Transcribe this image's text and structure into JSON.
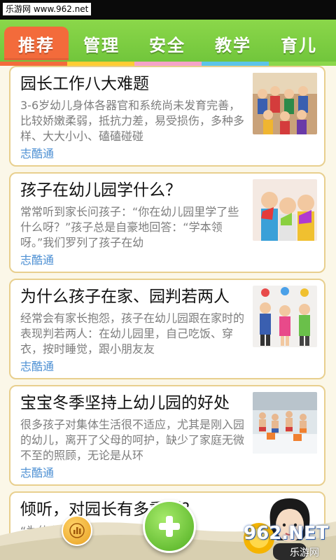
{
  "status_bar": {
    "watermark": "乐游网 www.962.net"
  },
  "tabs": [
    {
      "label": "推荐",
      "active": true
    },
    {
      "label": "管理",
      "active": false
    },
    {
      "label": "安全",
      "active": false
    },
    {
      "label": "教学",
      "active": false
    },
    {
      "label": "育儿",
      "active": false
    }
  ],
  "articles": [
    {
      "title": "园长工作八大难题",
      "summary": "3-6岁幼儿身体各器官和系统尚未发育完善，比较娇嫩柔弱，抵抗力差，易受损伤，多种多样、大大小小、磕磕碰碰",
      "source": "志酷通",
      "thumb": "kids-classroom-photo"
    },
    {
      "title": "孩子在幼儿园学什么？",
      "summary": "常常听到家长问孩子：“你在幼儿园里学了些什么呀？”孩子总是自豪地回答：“学本领呀。”我们罗列了孩子在幼",
      "source": "志酷通",
      "thumb": "kids-horns-photo"
    },
    {
      "title": "为什么孩子在家、园判若两人",
      "summary": "经常会有家长抱怨，孩子在幼儿园跟在家时的表现判若两人：在幼儿园里，自己吃饭、穿衣，按时睡觉，跟小朋友友",
      "source": "志酷通",
      "thumb": "kids-standing-photo"
    },
    {
      "title": "宝宝冬季坚持上幼儿园的好处",
      "summary": "很多孩子对集体生活很不适应，尤其是刚入园的幼儿，离开了父母的呵护，缺少了家庭无微不至的照顾，无论是从环",
      "source": "志酷通",
      "thumb": "kids-snow-photo"
    },
    {
      "title": "倾听，对园长有多重要？",
      "summary": "“为什么",
      "source": "",
      "thumb": "cartoon-woman"
    }
  ],
  "floating": {
    "chart_button": "chart-icon",
    "add_button": "plus-icon"
  },
  "corner_watermark": {
    "text": "962.NET",
    "subtext": "乐游网"
  },
  "colors": {
    "tab_bar": "#79c942",
    "tab_active": "#f36b3b",
    "card_border": "#e8cf8e",
    "source": "#4c8fd3",
    "add_button": "#63c22f"
  }
}
